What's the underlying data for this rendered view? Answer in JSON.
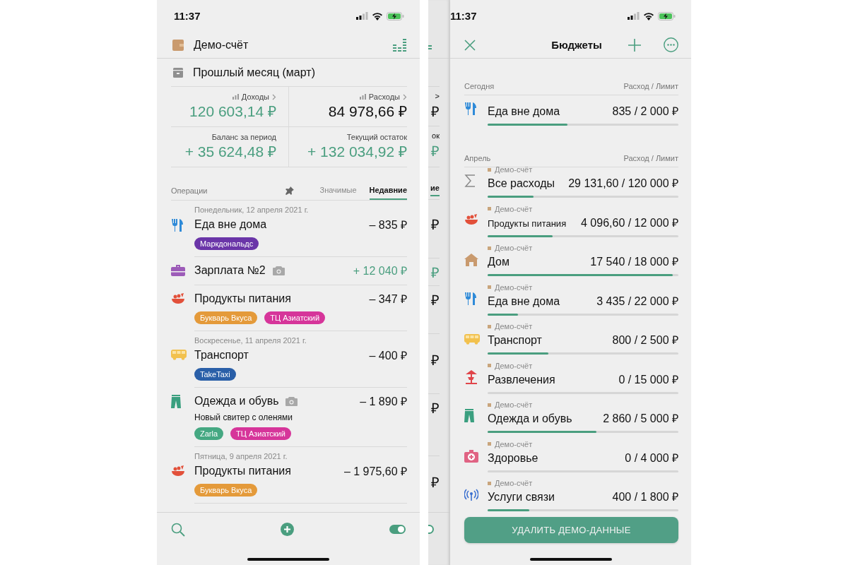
{
  "main": {
    "status_bar": {
      "time": "11:37"
    },
    "account": "Демо-счёт",
    "period": "Прошлый месяц (март)",
    "stats": [
      {
        "label": "Доходы",
        "link": true,
        "value": "120 603,14 ₽",
        "positive": true
      },
      {
        "label": "Расходы",
        "link": true,
        "value": "84 978,66 ₽",
        "positive": false
      },
      {
        "label": "Баланс за период",
        "link": false,
        "value": "+ 35 624,48 ₽",
        "positive": true
      },
      {
        "label": "Текущий остаток",
        "link": false,
        "value": "+ 132 034,92 ₽",
        "positive": true
      }
    ],
    "operations_title": "Операции",
    "tabs": [
      {
        "label": "Значимые",
        "selected": false
      },
      {
        "label": "Недавние",
        "selected": true
      }
    ],
    "groups": [
      {
        "date": "Понедельник, 12 апреля 2021 г.",
        "entries": [
          {
            "kind": "dining",
            "name": "Еда вне дома",
            "photo": false,
            "amount": "– 835 ₽",
            "positive": false,
            "tags": [
              {
                "label": "Маркдональдс",
                "color": "#6a35a8"
              }
            ]
          },
          {
            "kind": "salary",
            "name": "Зарплата №2",
            "photo": true,
            "amount": "+ 12 040 ₽",
            "positive": true
          },
          {
            "kind": "groceries",
            "name": "Продукты питания",
            "photo": false,
            "amount": "– 347 ₽",
            "positive": false,
            "tags": [
              {
                "label": "Букварь Вкуса",
                "color": "#e49a3a"
              },
              {
                "label": "ТЦ Азиатский",
                "color": "#d6359a"
              }
            ]
          }
        ]
      },
      {
        "date": "Воскресенье, 11 апреля 2021 г.",
        "entries": [
          {
            "kind": "transport",
            "name": "Транспорт",
            "photo": false,
            "amount": "– 400 ₽",
            "positive": false,
            "tags": [
              {
                "label": "TakeTaxi",
                "color": "#2a5fa8"
              }
            ]
          },
          {
            "kind": "clothes",
            "name": "Одежда и обувь",
            "photo": true,
            "note": "Новый свитер с оленями",
            "amount": "– 1 890 ₽",
            "positive": false,
            "tags": [
              {
                "label": "Zarla",
                "color": "#45a882"
              },
              {
                "label": "ТЦ Азиатский",
                "color": "#d6359a"
              }
            ]
          }
        ]
      },
      {
        "date": "Пятница, 9 апреля 2021 г.",
        "entries": [
          {
            "kind": "groceries",
            "name": "Продукты питания",
            "photo": false,
            "amount": "– 1 975,60 ₽",
            "positive": false,
            "tags": [
              {
                "label": "Букварь Вкуса",
                "color": "#e49a3a"
              }
            ]
          }
        ]
      }
    ],
    "bottom_bar": {
      "toggle_on": true
    }
  },
  "peek": [
    {
      "kind": "chart"
    },
    {
      "kind": "text",
      "text": ">",
      "positive": false
    },
    {
      "kind": "text",
      "text": "₽",
      "positive": false
    },
    {
      "kind": "text",
      "text": "ок",
      "positive": false
    },
    {
      "kind": "text",
      "text": "₽",
      "positive": true
    },
    {
      "kind": "tab",
      "text": "ие",
      "selected": true
    },
    {
      "kind": "text",
      "text": "₽",
      "positive": false
    },
    {
      "kind": "text",
      "text": "₽",
      "positive": true
    },
    {
      "kind": "text",
      "text": "₽",
      "positive": false
    },
    {
      "kind": "text",
      "text": "₽",
      "positive": false
    },
    {
      "kind": "text",
      "text": "₽",
      "positive": false
    },
    {
      "kind": "text",
      "text": "₽",
      "positive": false
    },
    {
      "kind": "toggle",
      "on": true
    }
  ],
  "budgets": {
    "status_bar": {
      "time": "11:37"
    },
    "title": "Бюджеты",
    "sections": [
      {
        "title": "Сегодня",
        "column": "Расход / Лимит",
        "items": [
          {
            "kind": "dining",
            "name": "Еда вне дома",
            "amount": "835 / 2 000 ₽",
            "level": 0.42
          }
        ]
      },
      {
        "title": "Апрель",
        "column": "Расход / Лимит",
        "items": [
          {
            "kind": "sum",
            "account": "Демо-счёт",
            "name": "Все расходы",
            "amount": "29 131,60 / 120 000 ₽",
            "level": 0.24
          },
          {
            "kind": "groceries",
            "account": "Демо-счёт",
            "name": "Продукты питания",
            "amount": "4 096,60 / 12 000 ₽",
            "level": 0.34
          },
          {
            "kind": "home",
            "account": "Демо-счёт",
            "name": "Дом",
            "amount": "17 540 / 18 000 ₽",
            "level": 0.97
          },
          {
            "kind": "dining",
            "account": "Демо-счёт",
            "name": "Еда вне дома",
            "amount": "3 435 / 22 000 ₽",
            "level": 0.16
          },
          {
            "kind": "transport",
            "account": "Демо-счёт",
            "name": "Транспорт",
            "amount": "800 / 2 500 ₽",
            "level": 0.32
          },
          {
            "kind": "fun",
            "account": "Демо-счёт",
            "name": "Развлечения",
            "amount": "0 / 15 000 ₽",
            "level": 0
          },
          {
            "kind": "clothes",
            "account": "Демо-счёт",
            "name": "Одежда и обувь",
            "amount": "2 860 / 5 000 ₽",
            "level": 0.57
          },
          {
            "kind": "health",
            "account": "Демо-счёт",
            "name": "Здоровье",
            "amount": "0 / 4 000 ₽",
            "level": 0
          },
          {
            "kind": "telecom",
            "account": "Демо-счёт",
            "name": "Услуги связи",
            "amount": "400 / 1 800 ₽",
            "level": 0.22
          }
        ]
      }
    ],
    "action_button": "УДАЛИТЬ ДЕМО-ДАННЫЕ"
  }
}
